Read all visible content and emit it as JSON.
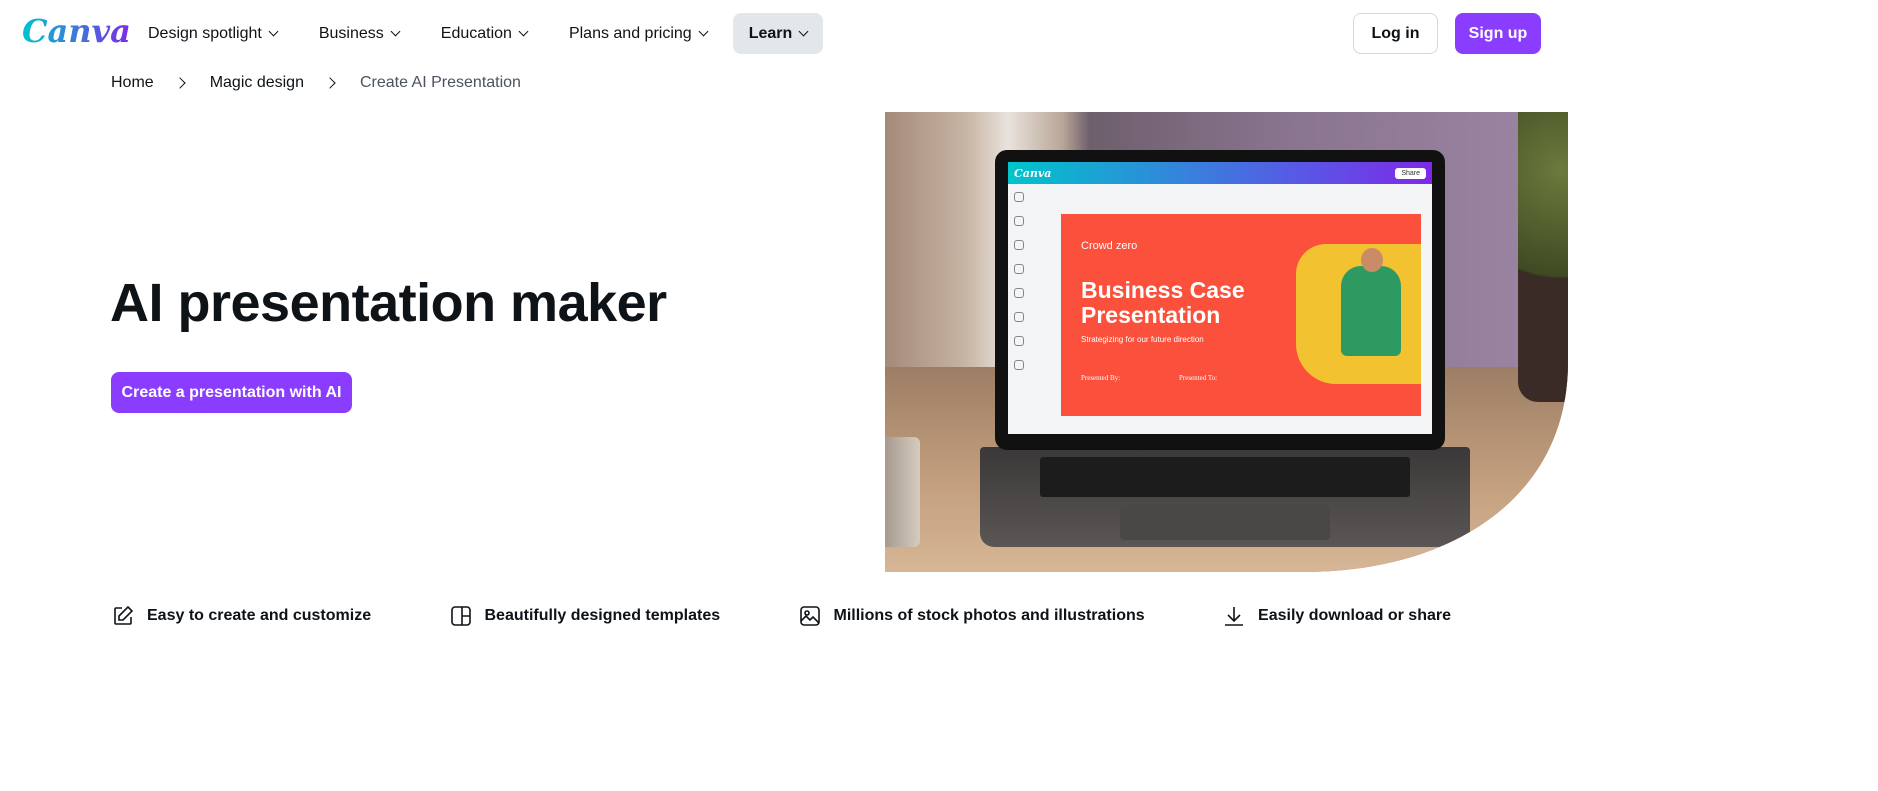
{
  "header": {
    "logo": "Canva",
    "nav": [
      {
        "label": "Design spotlight"
      },
      {
        "label": "Business"
      },
      {
        "label": "Education"
      },
      {
        "label": "Plans and pricing"
      },
      {
        "label": "Learn",
        "active": true
      }
    ],
    "login_label": "Log in",
    "signup_label": "Sign up"
  },
  "breadcrumb": [
    "Home",
    "Magic design",
    "Create AI Presentation"
  ],
  "hero": {
    "title": "AI presentation maker",
    "cta_label": "Create a presentation with AI",
    "image": {
      "editor_logo": "Canva",
      "share_label": "Share",
      "slide_brand": "Crowd zero",
      "slide_title": "Business Case Presentation",
      "slide_subtitle": "Strategizing for our future direction",
      "presented_by": "Presented By:",
      "presented_to": "Presented To:"
    }
  },
  "features": [
    {
      "icon": "pencil-square-icon",
      "label": "Easy to create and customize"
    },
    {
      "icon": "template-icon",
      "label": "Beautifully designed templates"
    },
    {
      "icon": "image-icon",
      "label": "Millions of stock photos and illustrations"
    },
    {
      "icon": "download-icon",
      "label": "Easily download or share"
    }
  ],
  "colors": {
    "brand": "#8b3dff",
    "slide": "#fb503b"
  }
}
